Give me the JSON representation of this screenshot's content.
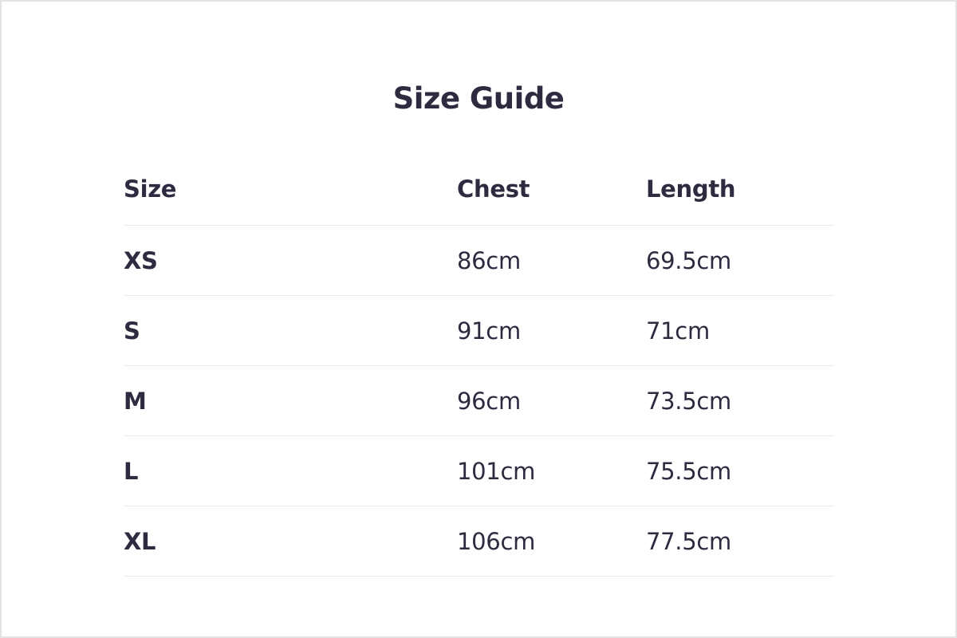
{
  "page": {
    "title": "Size Guide"
  },
  "table": {
    "headers": {
      "size": "Size",
      "chest": "Chest",
      "length": "Length"
    },
    "rows": [
      {
        "size": "XS",
        "chest": "86cm",
        "length": "69.5cm"
      },
      {
        "size": "S",
        "chest": "91cm",
        "length": "71cm"
      },
      {
        "size": "M",
        "chest": "96cm",
        "length": "73.5cm"
      },
      {
        "size": "L",
        "chest": "101cm",
        "length": "75.5cm"
      },
      {
        "size": "XL",
        "chest": "106cm",
        "length": "77.5cm"
      }
    ]
  },
  "colors": {
    "text": "#2f2a3f",
    "divider": "#ebebeb",
    "border": "#e3e3e3",
    "background": "#ffffff"
  }
}
